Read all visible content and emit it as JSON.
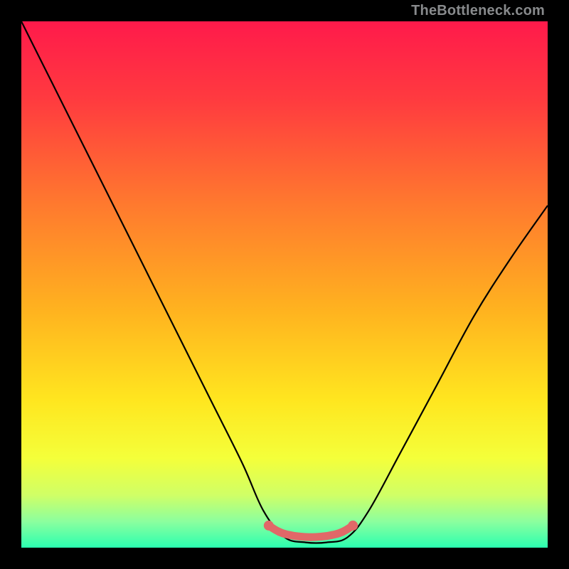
{
  "watermark": "TheBottleneck.com",
  "chart_data": {
    "type": "line",
    "title": "",
    "xlabel": "",
    "ylabel": "",
    "xlim": [
      0,
      100
    ],
    "ylim": [
      0,
      100
    ],
    "grid": false,
    "legend": false,
    "annotations": [],
    "series": [
      {
        "name": "bottleneck-curve",
        "x": [
          0,
          6,
          12,
          18,
          24,
          30,
          36,
          42,
          46,
          50,
          54,
          58,
          62,
          66,
          72,
          79,
          86,
          93,
          100
        ],
        "y": [
          100,
          88,
          76,
          64,
          52,
          40,
          28,
          16,
          7,
          2,
          1,
          1,
          2,
          7,
          18,
          31,
          44,
          55,
          65
        ]
      },
      {
        "name": "optimal-band-marker",
        "x": [
          47,
          49,
          51,
          53,
          55,
          57,
          59,
          61,
          63
        ],
        "y": [
          4.2,
          3.0,
          2.4,
          2.1,
          2.0,
          2.1,
          2.4,
          3.0,
          4.2
        ]
      }
    ],
    "gradient_stops": [
      {
        "offset": 0.0,
        "color": "#ff1a4b"
      },
      {
        "offset": 0.15,
        "color": "#ff3b3f"
      },
      {
        "offset": 0.35,
        "color": "#ff7a2e"
      },
      {
        "offset": 0.55,
        "color": "#ffb31f"
      },
      {
        "offset": 0.72,
        "color": "#ffe61f"
      },
      {
        "offset": 0.83,
        "color": "#f4ff3a"
      },
      {
        "offset": 0.9,
        "color": "#d0ff66"
      },
      {
        "offset": 0.95,
        "color": "#8cff9e"
      },
      {
        "offset": 1.0,
        "color": "#2bffb0"
      }
    ],
    "curve_color": "#000000",
    "marker_color": "#e16868"
  }
}
